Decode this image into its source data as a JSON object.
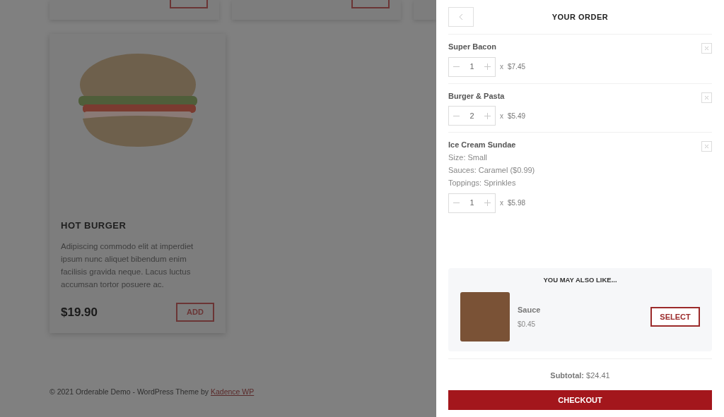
{
  "menu": {
    "cards": [
      {
        "name": "HOT BURGER",
        "description": "Adipiscing commodo elit at imperdiet ipsum nunc aliquet bibendum enim facilisis gravida neque. Lacus luctus accumsan tortor posuere ac.",
        "price": "$19.90",
        "button": "ADD"
      }
    ]
  },
  "footer": {
    "text": "© 2021 Orderable Demo - WordPress Theme by",
    "link": "Kadence WP"
  },
  "cart": {
    "title": "YOUR ORDER",
    "items": [
      {
        "name": "Super Bacon",
        "quantity": "1",
        "times": "x",
        "price": "$7.45"
      },
      {
        "name": "Burger & Pasta",
        "quantity": "2",
        "times": "x",
        "price": "$5.49"
      },
      {
        "name": "Ice Cream Sundae",
        "options": [
          "Size: Small",
          "Sauces: Caramel ($0.99)",
          "Toppings: Sprinkles"
        ],
        "quantity": "1",
        "times": "x",
        "price": "$5.98"
      }
    ],
    "upsell": {
      "title": "YOU MAY ALSO LIKE...",
      "products": [
        {
          "name": "Sauce",
          "price": "$0.45",
          "button": "SELECT"
        }
      ]
    },
    "subtotal": "**Subtotal:** $24.41",
    "checkout": "CHECKOUT"
  }
}
